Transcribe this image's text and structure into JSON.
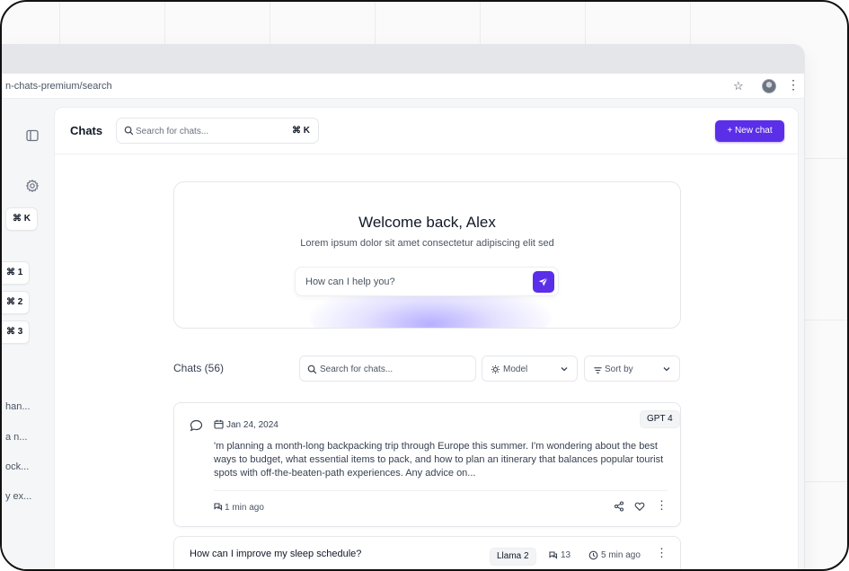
{
  "browser": {
    "url": "n-chats-premium/search"
  },
  "sidebar": {
    "shortcuts": [
      "⌘ K",
      "⌘ 1",
      "⌘ 2",
      "⌘ 3"
    ],
    "history": [
      "han...",
      "a n...",
      "ock...",
      "y ex..."
    ]
  },
  "header": {
    "title": "Chats",
    "search_placeholder": "Search for chats...",
    "search_shortcut": "⌘ K",
    "new_chat_label": "+ New chat"
  },
  "hero": {
    "welcome": "Welcome back, Alex",
    "subtitle": "Lorem ipsum dolor sit amet consectetur adipiscing elit sed",
    "prompt_placeholder": "How can I help you?"
  },
  "list": {
    "title": "Chats (56)",
    "search_placeholder": "Search for chats...",
    "model_label": "Model",
    "sort_label": "Sort by"
  },
  "chats": [
    {
      "date": "Jan 24, 2024",
      "model": "GPT 4",
      "excerpt": "'m planning a month-long backpacking trip through Europe this summer. I'm wondering about the best ways to budget, what essential items to pack, and how to plan an itinerary that balances popular tourist spots with off-the-beaten-path experiences. Any advice on...",
      "updated": "1 min ago"
    },
    {
      "question": "How can I improve my sleep schedule?",
      "model": "Llama 2",
      "count": "13",
      "updated": "5 min ago"
    }
  ],
  "colors": {
    "accent": "#5b2ee8"
  }
}
